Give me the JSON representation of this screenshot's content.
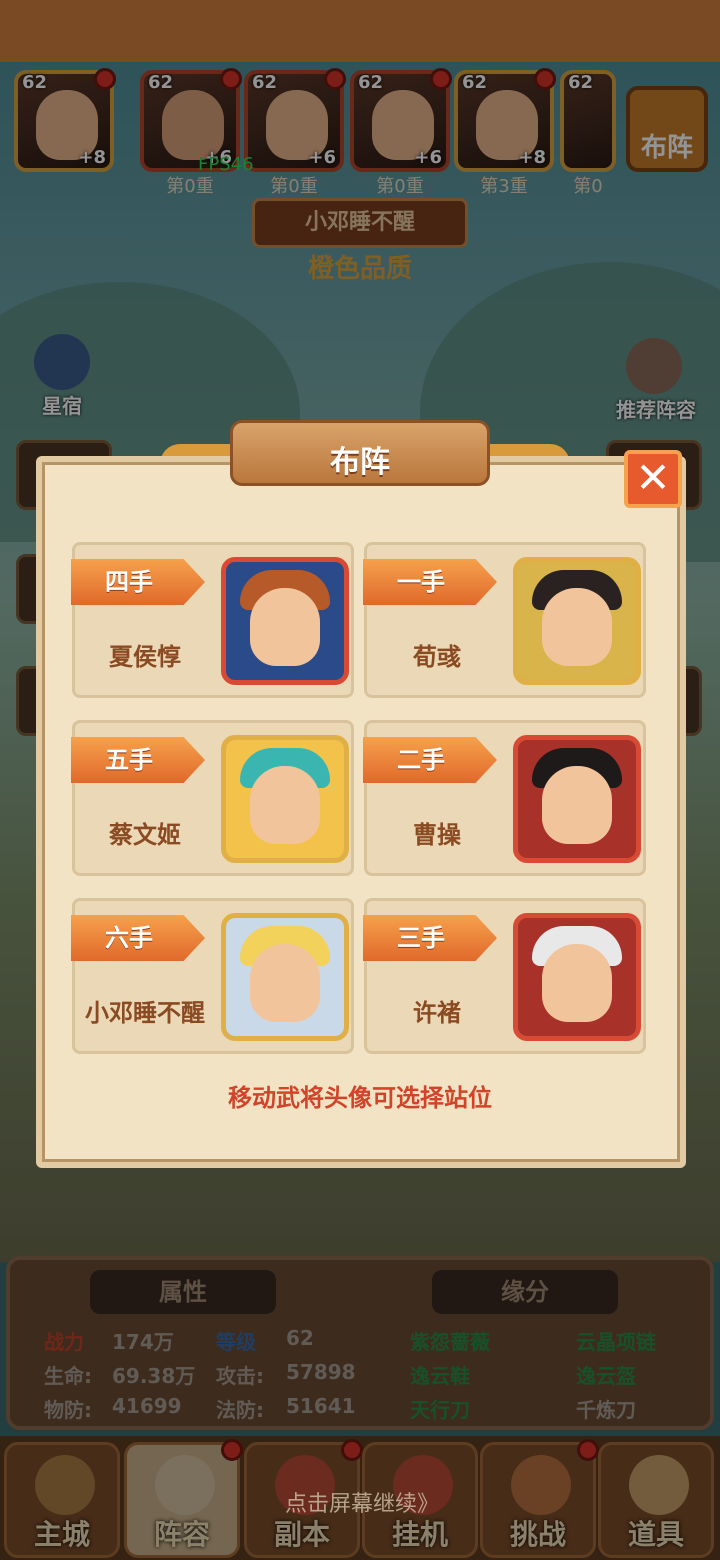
{
  "status_bar": {
    "left": "",
    "right": ""
  },
  "team_bar": {
    "heroes": [
      {
        "level": "62",
        "plus": "+8",
        "rank": ""
      },
      {
        "level": "62",
        "plus": "+6",
        "rank": "第0重"
      },
      {
        "level": "62",
        "plus": "+6",
        "rank": "第0重"
      },
      {
        "level": "62",
        "plus": "+6",
        "rank": "第0重"
      },
      {
        "level": "62",
        "plus": "+8",
        "rank": "第3重"
      },
      {
        "level": "62",
        "plus": "",
        "rank": "第0"
      }
    ],
    "formation_label": "布阵",
    "fps": "FPS46"
  },
  "hero_header": {
    "name": "小邓睡不醒",
    "quality": "橙色品质"
  },
  "side_buttons": {
    "left_label": "星宿",
    "right_label": "推荐阵容"
  },
  "modal": {
    "title": "布阵",
    "close_label": "✕",
    "hint": "移动武将头像可选择站位",
    "slots": [
      {
        "position": "四手",
        "name": "夏侯惇",
        "frame": "red",
        "hair": "#b65a2a",
        "bg": "#2a4a8a"
      },
      {
        "position": "一手",
        "name": "荀彧",
        "frame": "gold",
        "hair": "#2a2220",
        "bg": "#d9b44a"
      },
      {
        "position": "五手",
        "name": "蔡文姬",
        "frame": "gold",
        "hair": "#3ab5b0",
        "bg": "#f2c24a"
      },
      {
        "position": "二手",
        "name": "曹操",
        "frame": "red",
        "hair": "#1e1a1a",
        "bg": "#a8322a"
      },
      {
        "position": "六手",
        "name": "小邓睡不醒",
        "frame": "gold",
        "hair": "#f2d25a",
        "bg": "#c9d9e8"
      },
      {
        "position": "三手",
        "name": "许褚",
        "frame": "red",
        "hair": "#e8e8e8",
        "bg": "#a8322a"
      }
    ]
  },
  "stats": {
    "attr_header": "属性",
    "fate_header": "缘分",
    "power_label": "战力",
    "power_value": "174万",
    "level_label": "等级",
    "level_value": "62",
    "hp_label": "生命:",
    "hp_value": "69.38万",
    "atk_label": "攻击:",
    "atk_value": "57898",
    "pdef_label": "物防:",
    "pdef_value": "41699",
    "mdef_label": "法防:",
    "mdef_value": "51641",
    "fates": [
      "紫怨蔷薇",
      "云晶项链",
      "逸云鞋",
      "逸云盔",
      "天行刀",
      "千炼刀"
    ]
  },
  "bottom_nav": {
    "items": [
      "主城",
      "阵容",
      "副本",
      "挂机",
      "挑战",
      "道具"
    ],
    "continue_hint": "点击屏幕继续》"
  },
  "colors": {
    "accent_orange": "#e0692a",
    "frame_red": "#d84a34",
    "frame_gold": "#e0b046",
    "hint_red": "#d0452a"
  }
}
